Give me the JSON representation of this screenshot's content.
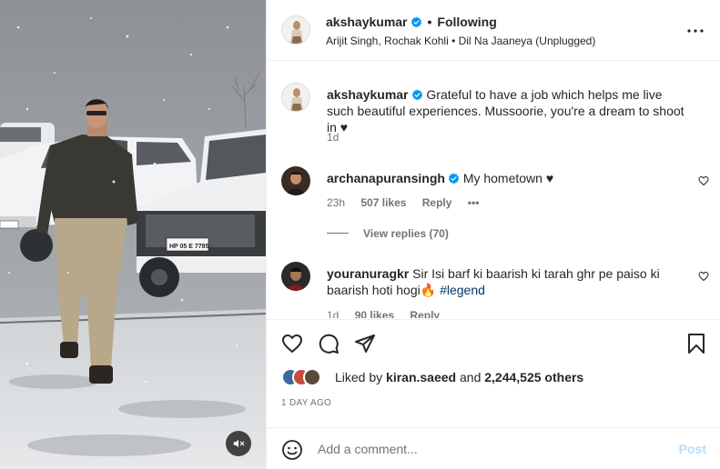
{
  "post": {
    "username": "akshaykumar",
    "follow_status": "Following",
    "audio": "Arijit Singh, Rochak Kohli • Dil Na Jaaneya (Unplugged)",
    "caption": "Grateful to have a job which helps me live such beautiful experiences. Mussoorie, you're a dream to shoot in ♥",
    "caption_time": "1d"
  },
  "comments": [
    {
      "username": "archanapuransingh",
      "verified": true,
      "text": "My hometown ♥",
      "time": "23h",
      "likes": "507 likes",
      "reply": "Reply",
      "view_replies": "View replies (70)"
    },
    {
      "username": "youranuragkr",
      "verified": false,
      "text": "Sir Isi barf ki baarish ki tarah ghr pe paiso ki baarish hoti hogi🔥",
      "hashtag": "#legend",
      "time": "1d",
      "likes": "90 likes",
      "reply": "Reply"
    }
  ],
  "engagement": {
    "liked_by_prefix": "Liked by",
    "liked_by_user": "kiran.saeed",
    "and_word": "and",
    "others": "2,244,525 others",
    "date": "1 DAY AGO"
  },
  "add_comment": {
    "placeholder": "Add a comment...",
    "post_label": "Post"
  },
  "icons": {
    "verified": "verified-badge-icon",
    "more": "more-options-icon",
    "like": "heart-icon",
    "comment": "comment-icon",
    "share": "share-icon",
    "save": "bookmark-icon",
    "emoji": "emoji-icon",
    "mute": "audio-muted-icon"
  },
  "colors": {
    "verified_blue": "#0095f6",
    "post_disabled": "#b2dffc",
    "hashtag": "#00376b",
    "secondary_text": "#737373"
  }
}
